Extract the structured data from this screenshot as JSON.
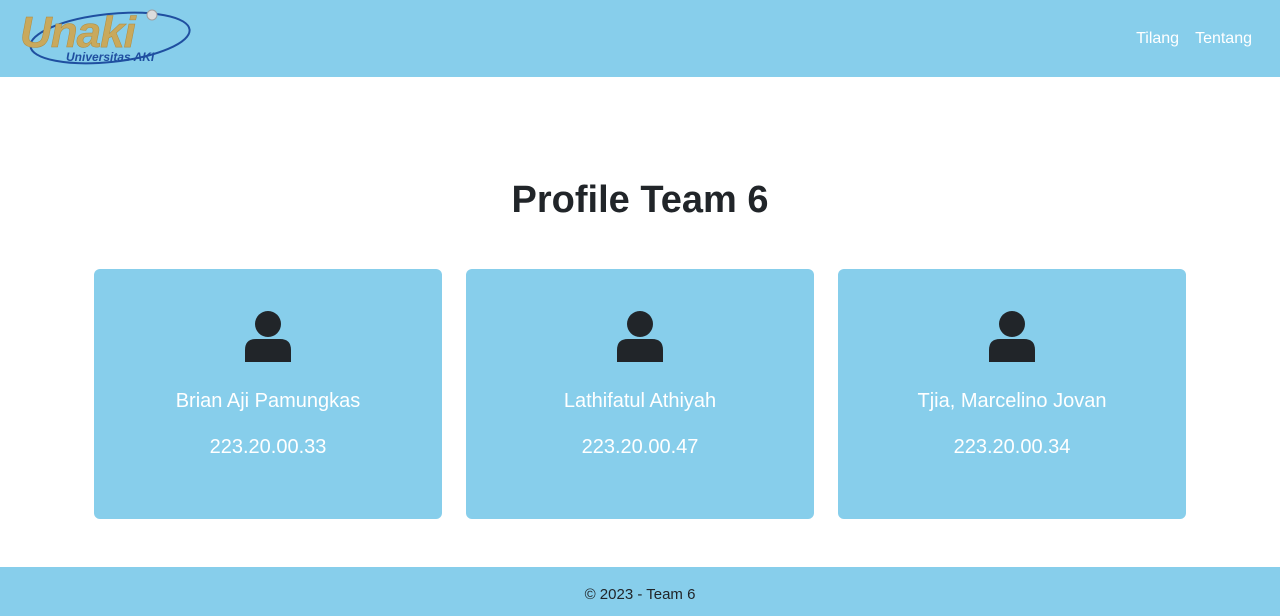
{
  "colors": {
    "accent": "#87ceeb",
    "text": "#212529",
    "logo_gold": "#c9a95c",
    "logo_blue": "#1f4fa0"
  },
  "header": {
    "logo": {
      "main_text": "Unaki",
      "sub_text": "Universitas AKI"
    },
    "nav": [
      {
        "label": "Tilang"
      },
      {
        "label": "Tentang"
      }
    ]
  },
  "main": {
    "title": "Profile Team 6",
    "members": [
      {
        "icon": "person-icon",
        "name": "Brian Aji Pamungkas",
        "nim": "223.20.00.33"
      },
      {
        "icon": "person-icon",
        "name": "Lathifatul Athiyah",
        "nim": "223.20.00.47"
      },
      {
        "icon": "person-icon",
        "name": "Tjia, Marcelino Jovan",
        "nim": "223.20.00.34"
      }
    ]
  },
  "footer": {
    "text": "© 2023 - Team 6"
  }
}
